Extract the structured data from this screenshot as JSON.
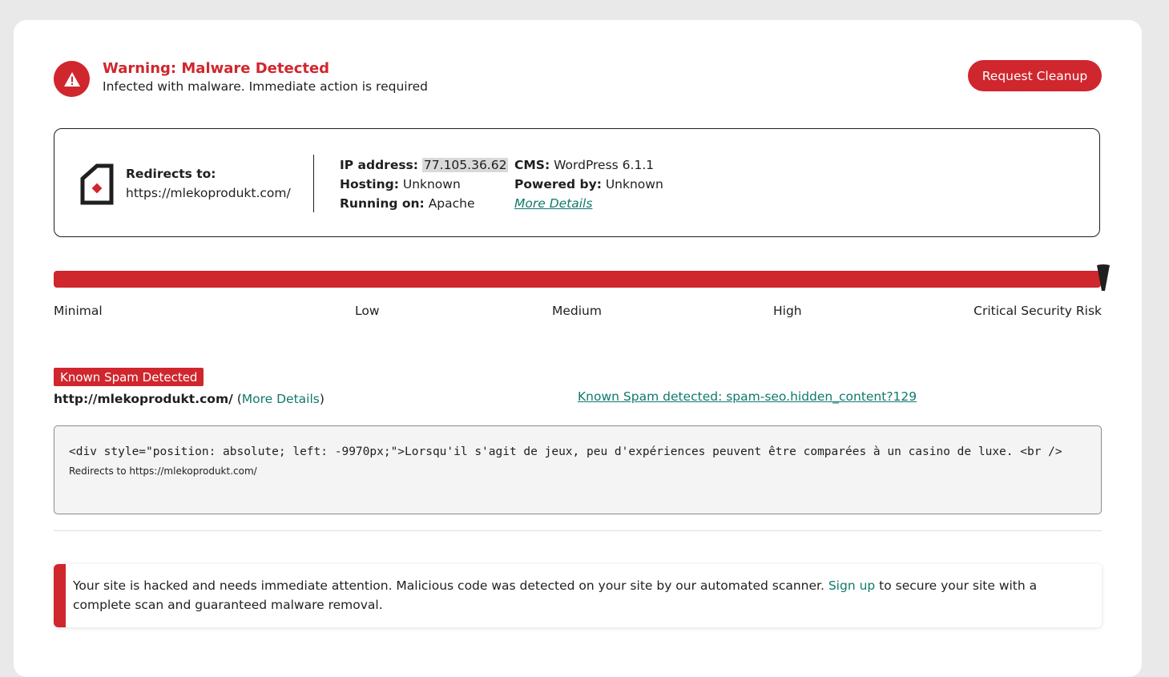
{
  "header": {
    "title": "Warning: Malware Detected",
    "subtitle": "Infected with malware. Immediate action is required",
    "cleanup_button": "Request Cleanup",
    "icon": "warning-icon"
  },
  "site_info": {
    "icon": "site-icon",
    "redirects_label": "Redirects to:",
    "redirects_url": "https://mlekoprodukt.com/",
    "ip_label": "IP address:",
    "ip_value": "77.105.36.62",
    "hosting_label": "Hosting:",
    "hosting_value": "Unknown",
    "running_label": "Running on:",
    "running_value": "Apache",
    "cms_label": "CMS:",
    "cms_value": "WordPress 6.1.1",
    "powered_label": "Powered by:",
    "powered_value": "Unknown",
    "more_details": "More Details"
  },
  "risk": {
    "levels": [
      "Minimal",
      "Low",
      "Medium",
      "High",
      "Critical Security Risk"
    ],
    "current_level": "Critical Security Risk",
    "fill_fraction": 1.0,
    "bar_color": "#d0262d"
  },
  "spam": {
    "badge": "Known Spam Detected",
    "url": "http://mlekoprodukt.com/",
    "paren_open": " (",
    "more_details": "More Details",
    "paren_close": ")",
    "signature": "Known Spam detected: spam-seo.hidden_content?129",
    "code": "<div style=\"position: absolute; left: -9970px;\">Lorsqu'il s'agit de jeux, peu d'expériences peuvent être comparées à un casino de luxe. <br />",
    "code_note": "Redirects to https://mlekoprodukt.com/"
  },
  "alert": {
    "text_before": "Your site is hacked and needs immediate attention. Malicious code was detected on your site by our automated scanner. ",
    "signup": "Sign up",
    "text_after": " to secure your site with a complete scan and guaranteed malware removal."
  },
  "colors": {
    "accent": "#d0262d",
    "link": "#0f7a6b"
  }
}
